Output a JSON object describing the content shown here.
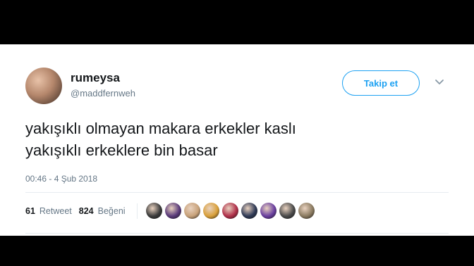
{
  "user": {
    "name": "rumeysa",
    "handle": "@maddfernweh"
  },
  "follow_label": "Takip et",
  "tweet": {
    "lines": [
      "yakışıklı olmayan makara erkekler kaslı",
      "yakışıklı erkeklere bin basar"
    ],
    "timestamp": "00:46 - 4 Şub 2018"
  },
  "stats": {
    "retweet_count": "61",
    "retweet_label": "Retweet",
    "like_count": "824",
    "like_label": "Beğeni"
  },
  "likers": [
    {
      "color": "#3b3b3b"
    },
    {
      "color": "#5a3a7a"
    },
    {
      "color": "#c8a27a"
    },
    {
      "color": "#d9a03a"
    },
    {
      "color": "#b0304a"
    },
    {
      "color": "#2f3a56"
    },
    {
      "color": "#6a3fa0"
    },
    {
      "color": "#4a4a4a"
    },
    {
      "color": "#8a7a60"
    }
  ]
}
